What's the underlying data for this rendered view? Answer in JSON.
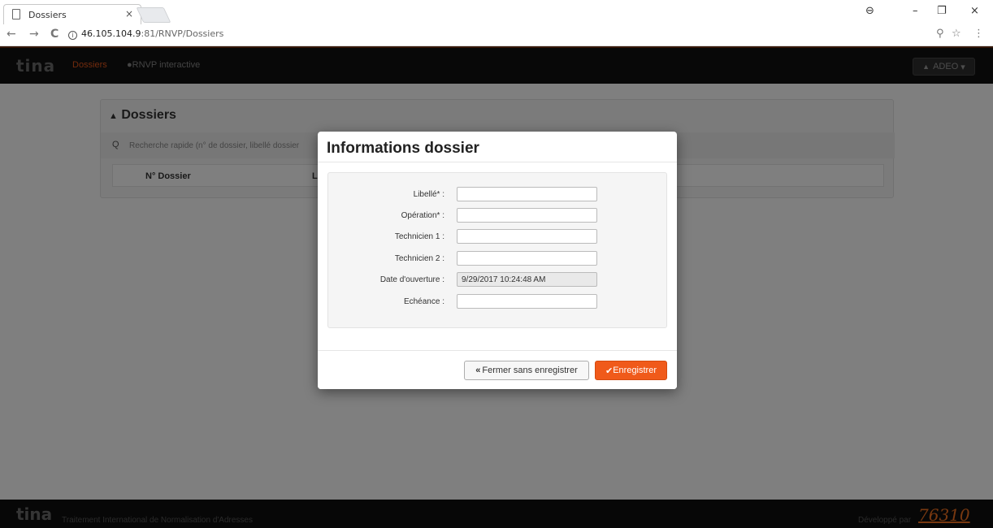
{
  "browser": {
    "tab_title": "Dossiers",
    "tab_close": "×",
    "url_host": "46.105.104.9",
    "url_path": ":81/RNVP/Dossiers",
    "back": "←",
    "forward": "→",
    "reload": "C",
    "info": "i",
    "key_icon": "⚲",
    "star": "☆",
    "menu": "⋮",
    "profile": "⊖",
    "minimize": "–",
    "restore": "❐",
    "close": "×"
  },
  "navbar": {
    "logo": "tina",
    "links": [
      "Dossiers",
      "RNVP interactive"
    ],
    "globe": "●",
    "user": "ADEO",
    "user_icon": "▲",
    "caret": "▾",
    "active_color": "#e4561b"
  },
  "panel": {
    "title": "Dossiers",
    "title_icon": "▲",
    "search_icon": "Q",
    "search_placeholder": "Recherche rapide (n° de dossier, libellé dossier",
    "columns": [
      "N° Dossier",
      "Li"
    ]
  },
  "modal": {
    "title": "Informations dossier",
    "fields": [
      {
        "label": "Libellé* :",
        "value": ""
      },
      {
        "label": "Opération* :",
        "value": ""
      },
      {
        "label": "Technicien 1 :",
        "value": ""
      },
      {
        "label": "Technicien 2 :",
        "value": ""
      },
      {
        "label": "Date d'ouverture :",
        "value": "9/29/2017 10:24:48 AM"
      },
      {
        "label": "Echéance :",
        "value": ""
      }
    ],
    "close_icon": "«",
    "close_label": "Fermer sans enregistrer",
    "save_icon": "✔",
    "save_label": "Enregistrer",
    "save_color": "#f05a1a"
  },
  "footer": {
    "logo": "tina",
    "text": "Traitement International de Normalisation d'Adresses",
    "dev": "Développé par",
    "brand": "76310"
  }
}
